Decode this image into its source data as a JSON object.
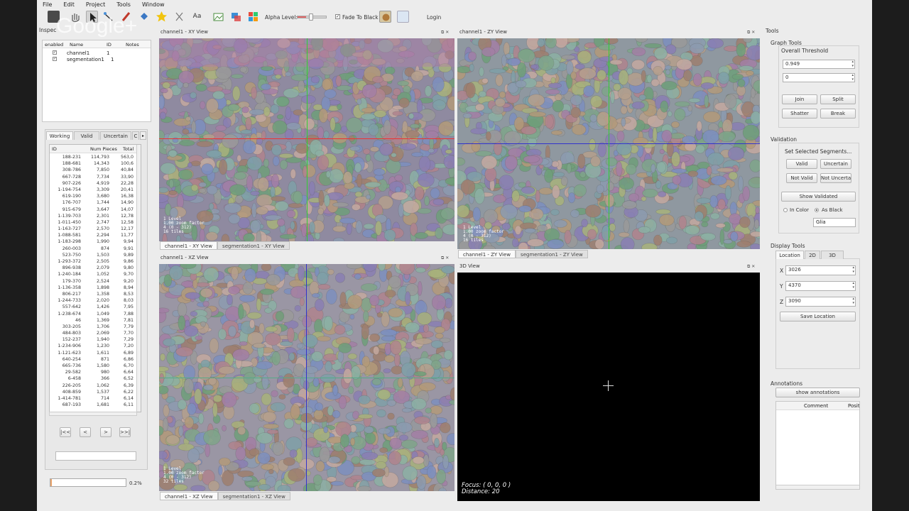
{
  "menu": [
    "File",
    "Edit",
    "Project",
    "Tools",
    "Window"
  ],
  "toolbar": {
    "alpha_label": "Alpha Level:",
    "fade_label": "Fade To Black",
    "fade_checked": true,
    "login": "Login"
  },
  "watermark": "Google+",
  "inspector": {
    "title": "Inspec",
    "columns": [
      "enabled",
      "Name",
      "ID",
      "Notes"
    ],
    "rows": [
      {
        "name": "channel1",
        "id": "1"
      },
      {
        "name": "segmentation1",
        "id": "1"
      }
    ]
  },
  "segment_list": {
    "tabs": [
      "Working",
      "Valid",
      "Uncertain",
      "C"
    ],
    "columns": [
      "ID",
      "Num Pieces",
      "Total"
    ],
    "rows": [
      [
        "188-231",
        "114,793",
        "563,0"
      ],
      [
        "188-681",
        "14,343",
        "100,6"
      ],
      [
        "308-786",
        "7,850",
        "40,84"
      ],
      [
        "667-728",
        "7,734",
        "33,90"
      ],
      [
        "907-226",
        "4,919",
        "22,28"
      ],
      [
        "1-194-754",
        "3,309",
        "20,41"
      ],
      [
        "619-190",
        "3,680",
        "16,38"
      ],
      [
        "176-707",
        "1,744",
        "14,90"
      ],
      [
        "915-679",
        "3,647",
        "14,07"
      ],
      [
        "1-139-703",
        "2,301",
        "12,78"
      ],
      [
        "1-011-450",
        "2,747",
        "12,58"
      ],
      [
        "1-163-727",
        "2,570",
        "12,17"
      ],
      [
        "1-088-581",
        "2,294",
        "11,77"
      ],
      [
        "1-183-298",
        "1,990",
        "9,94"
      ],
      [
        "260-003",
        "874",
        "9,91"
      ],
      [
        "523-750",
        "1,503",
        "9,89"
      ],
      [
        "1-293-372",
        "2,505",
        "9,86"
      ],
      [
        "896-938",
        "2,079",
        "9,80"
      ],
      [
        "1-240-184",
        "1,052",
        "9,70"
      ],
      [
        "179-370",
        "2,524",
        "9,20"
      ],
      [
        "1-136-358",
        "1,898",
        "8,94"
      ],
      [
        "806-217",
        "1,358",
        "8,53"
      ],
      [
        "1-244-733",
        "2,020",
        "8,03"
      ],
      [
        "557-642",
        "1,426",
        "7,95"
      ],
      [
        "1-238-674",
        "1,049",
        "7,88"
      ],
      [
        "46",
        "1,369",
        "7,81"
      ],
      [
        "303-205",
        "1,706",
        "7,79"
      ],
      [
        "484-803",
        "2,069",
        "7,70"
      ],
      [
        "152-237",
        "1,940",
        "7,29"
      ],
      [
        "1-234-906",
        "1,230",
        "7,20"
      ],
      [
        "1-121-623",
        "1,611",
        "6,89"
      ],
      [
        "640-254",
        "871",
        "6,86"
      ],
      [
        "665-736",
        "1,580",
        "6,70"
      ],
      [
        "29-582",
        "980",
        "6,64"
      ],
      [
        "6-458",
        "366",
        "6,52"
      ],
      [
        "226-205",
        "1,062",
        "6,39"
      ],
      [
        "408-859",
        "1,537",
        "6,22"
      ],
      [
        "1-414-781",
        "714",
        "6,14"
      ],
      [
        "687-193",
        "1,681",
        "6,11"
      ]
    ],
    "nav": [
      "|<<",
      "<",
      ">",
      ">>|"
    ]
  },
  "progress": {
    "text": "0.2%",
    "value": 0.02
  },
  "views": {
    "xy": {
      "title": "channel1 - XY View",
      "tabs": [
        "channel1 - XY View",
        "segmentation1 - XY View"
      ],
      "hud": [
        "1 Level",
        "1.00 zoom factor",
        "4 (0 - 312)",
        "16 tiles"
      ]
    },
    "zy": {
      "title": "channel1 - ZY View",
      "tabs": [
        "channel1 - ZY View",
        "segmentation1 - ZY View"
      ],
      "hud": [
        "1 Level",
        "1.00 zoom factor",
        "4 (0 - 312)",
        "16 tiles"
      ]
    },
    "xz": {
      "title": "channel1 - XZ View",
      "tabs": [
        "channel1 - XZ View",
        "segmentation1 - XZ View"
      ],
      "hud": [
        "1 Level",
        "1.00 zoom factor",
        "4 (0 - 312)",
        "32 tiles"
      ]
    },
    "v3d": {
      "title": "3D View",
      "focus": "Focus: ( 0, 0, 0 )",
      "distance": "Distance: 20"
    }
  },
  "tools": {
    "title": "Tools",
    "graph": {
      "title": "Graph Tools",
      "threshold_label": "Overall Threshold",
      "threshold": "0.949",
      "second": "0",
      "buttons": [
        "Join",
        "Split",
        "Shatter",
        "Break"
      ]
    },
    "validation": {
      "title": "Validation",
      "subtitle": "Set Selected Segments...",
      "buttons": [
        "Valid",
        "Uncertain",
        "Not Valid",
        "Not Uncertain"
      ],
      "show": "Show Validated",
      "in_color": "In Color",
      "as_black": "As Black",
      "glia": "Glia"
    },
    "display": {
      "title": "Display Tools",
      "tabs": [
        "Location",
        "2D",
        "3D"
      ],
      "x_label": "X",
      "x": "3026",
      "y_label": "Y",
      "y": "4370",
      "z_label": "Z",
      "z": "3090",
      "save": "Save Location"
    },
    "annotations": {
      "title": "Annotations",
      "show": "show annotations",
      "columns": [
        "Comment",
        "Posit"
      ]
    }
  }
}
